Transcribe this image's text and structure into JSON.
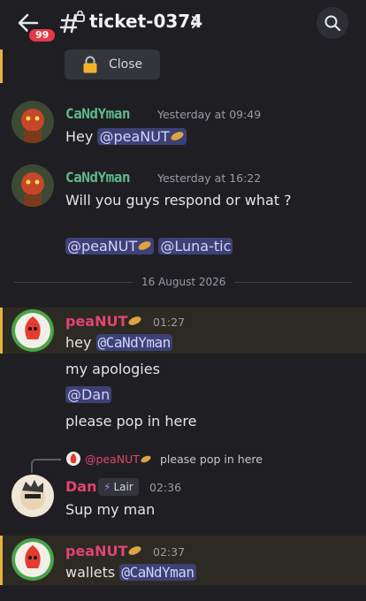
{
  "header": {
    "badge_count": "99",
    "channel_name": "ticket-0374"
  },
  "close_button": {
    "label": "Close"
  },
  "messages": [
    {
      "author": "CaNdYman",
      "time": "Yesterday at 09:49",
      "text_prefix": "Hey ",
      "mention": "@peaNUT"
    },
    {
      "author": "CaNdYman",
      "time": "Yesterday at 16:22",
      "text": "Will you guys respond or what ?",
      "mention1": "@peaNUT",
      "mention2": "@Luna-tic"
    },
    {
      "author": "peaNUT",
      "time": "01:27",
      "line1_prefix": "hey ",
      "line1_mention": "@CaNdYman",
      "line2": "my apologies",
      "line3_mention": "@Dan",
      "line4": "please pop in here"
    },
    {
      "author": "Dan",
      "role_tag": "Lair",
      "time": "02:36",
      "text": "Sup my man",
      "reply_to": "@peaNUT",
      "reply_text": "please pop in here"
    },
    {
      "author": "peaNUT",
      "time": "02:37",
      "text_prefix": "wallets ",
      "mention": "@CaNdYman"
    }
  ],
  "date_divider": "16 August 2026",
  "colors": {
    "background": "#1f1f23",
    "mention_highlight": "#2c2a22",
    "mention_bar": "#e6b43d",
    "mention_pill": "#3d4174",
    "candyman_name": "#5fb98c",
    "peanut_name": "#e2456f",
    "badge": "#e53946"
  },
  "icons": [
    "back-arrow-icon",
    "hash-lock-icon",
    "chevron-right-icon",
    "search-icon",
    "lock-icon",
    "peanut-emoji-icon",
    "lightning-icon"
  ]
}
